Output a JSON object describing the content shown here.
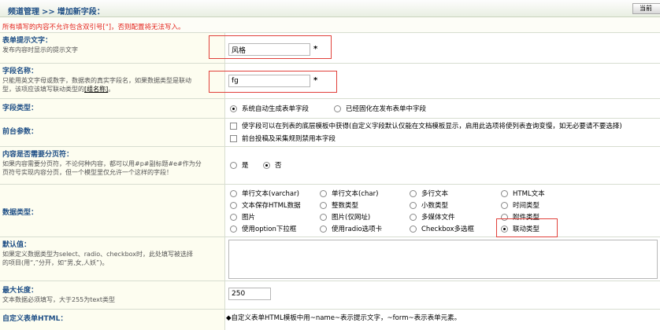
{
  "header": {
    "crumb_section": "频道管理",
    "crumb_sep": ">>",
    "crumb_page": "增加新字段：",
    "current_btn": "当前"
  },
  "notice": "所有填写的内容不允许包含双引号[\"]，否则配置将无法写入。",
  "fields": {
    "prompt": {
      "title": "表单提示文字：",
      "desc": "发布内容时显示的提示文字",
      "value": "风格",
      "star": "*"
    },
    "name": {
      "title": "字段名称：",
      "desc1": "只能用英文字母或数字，数据表的真实字段名，如果数据类型是联动",
      "desc2": "型，该项应该填写联动类型的",
      "link": "[组名称]",
      "desc2_end": "。",
      "value": "fg",
      "star": "*"
    },
    "field_type": {
      "title": "字段类型：",
      "options": [
        "系统自动生成表单字段",
        "已经固化在发布表单中字段"
      ],
      "selected": 0
    },
    "frontend": {
      "title": "前台参数：",
      "checks": [
        "使字段可以在列表的底层模板中获得(自定义字段默认仅能在文档模板显示，启用此选项将使列表查询变慢，如无必要请不要选择)",
        "前台投稿及采集规则禁用本字段"
      ]
    },
    "paging": {
      "title": "内容是否需要分页符：",
      "desc1": "如果内容需要分页符，不论何种内容，都可以用#p#副标题#e#作为分",
      "desc2": "页符号实现内容分页，但一个模型里仅允许一个这样的字段！",
      "options": [
        "是",
        "否"
      ],
      "selected": 1
    },
    "data_type": {
      "title": "数据类型：",
      "options": [
        "单行文本(varchar)",
        "单行文本(char)",
        "多行文本",
        "HTML文本",
        "文本保存HTML数据",
        "整数类型",
        "小数类型",
        "时间类型",
        "图片",
        "图片(仅网址)",
        "多媒体文件",
        "附件类型",
        "使用option下拉框",
        "使用radio选项卡",
        "Checkbox多选框",
        "联动类型"
      ],
      "selected": 15
    },
    "default_value": {
      "title": "默认值：",
      "desc1": "如果定义数据类型为select、radio、checkbox时，此处填写被选择",
      "desc2": "的项目(用“,”分开，如“男,女,人妖”)。"
    },
    "max_length": {
      "title": "最大长度：",
      "desc": "文本数据必须填写，大于255为text类型",
      "value": "250"
    },
    "custom_html": {
      "title": "自定义表单HTML：",
      "note": "◆自定义表单HTML模板中用~name~表示提示文字，~form~表示表单元素。"
    }
  },
  "colors": {
    "label_title": "#1f4f86",
    "notice": "#e4241c",
    "highlight_box": "#e0403a"
  }
}
